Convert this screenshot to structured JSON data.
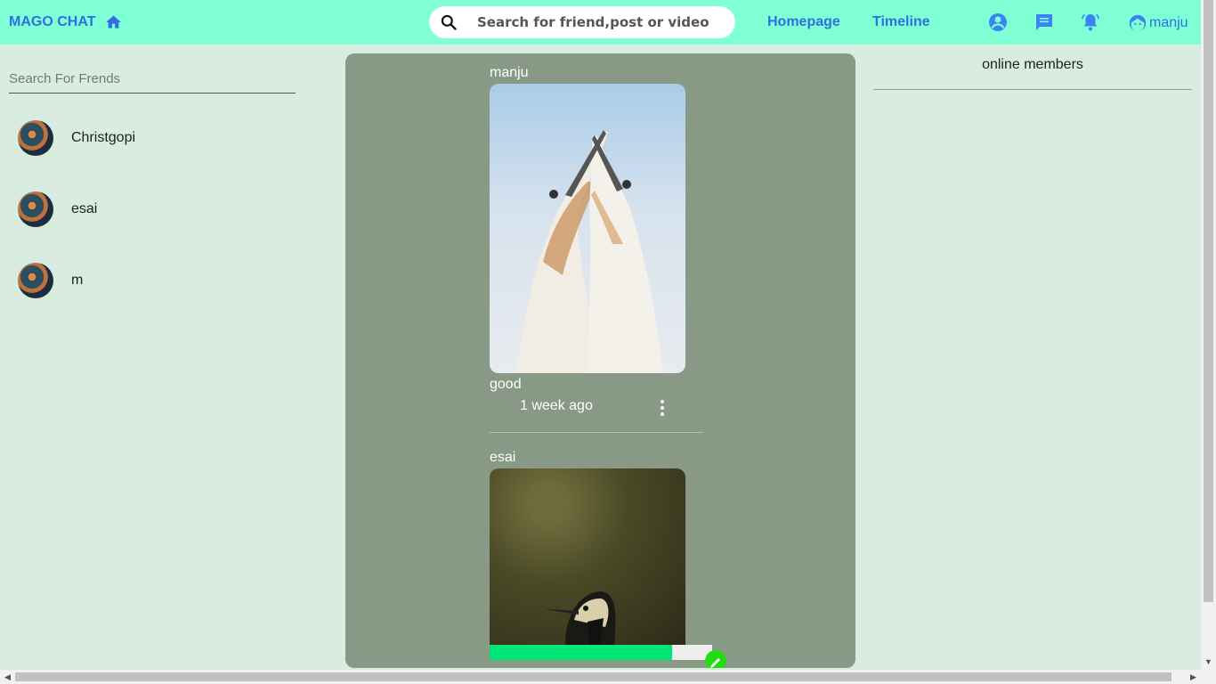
{
  "header": {
    "brand": "MAGO CHAT",
    "search_placeholder": "Search for friend,post or video",
    "nav": [
      "Homepage",
      "Timeline"
    ],
    "username": "manju"
  },
  "sidebar": {
    "search_placeholder": "Search For Frends",
    "friends": [
      "Christgopi",
      "esai",
      "m"
    ]
  },
  "feed": {
    "posts": [
      {
        "user": "manju",
        "description": "good",
        "time": "1 week ago",
        "image": "two gannets"
      },
      {
        "user": "esai",
        "image": "woodpecker"
      }
    ],
    "upload_progress": 0.82
  },
  "online": {
    "title": "online members"
  },
  "colors": {
    "header": "#7fffd4",
    "accent": "#2f6fe0",
    "feed": "#889a86",
    "page": "#d9ece0",
    "progress": "#00e676"
  }
}
